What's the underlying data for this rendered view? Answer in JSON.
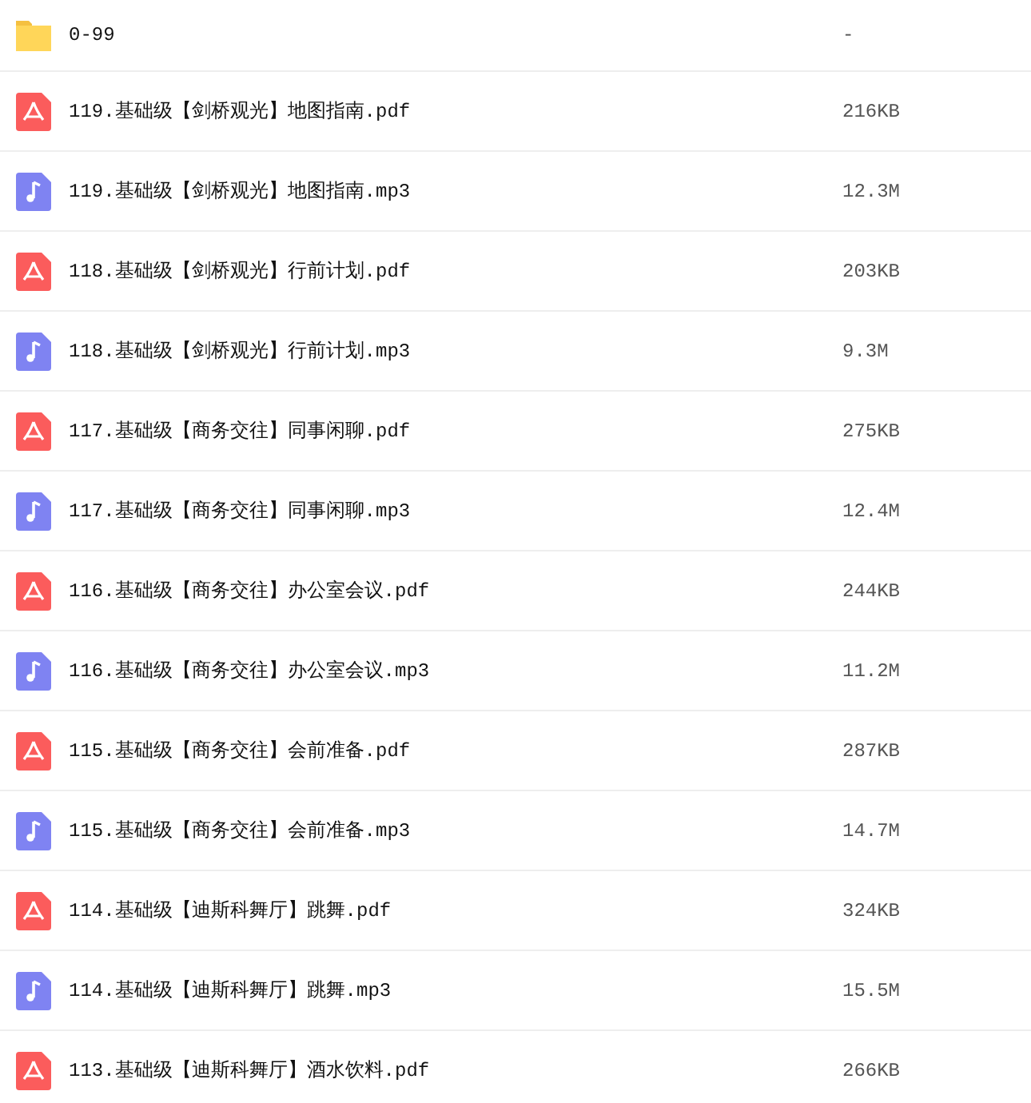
{
  "files": [
    {
      "kind": "folder",
      "name": "0-99",
      "size": "-"
    },
    {
      "kind": "pdf",
      "name": "119.基础级【剑桥观光】地图指南.pdf",
      "size": "216KB"
    },
    {
      "kind": "audio",
      "name": "119.基础级【剑桥观光】地图指南.mp3",
      "size": "12.3M"
    },
    {
      "kind": "pdf",
      "name": "118.基础级【剑桥观光】行前计划.pdf",
      "size": "203KB"
    },
    {
      "kind": "audio",
      "name": "118.基础级【剑桥观光】行前计划.mp3",
      "size": "9.3M"
    },
    {
      "kind": "pdf",
      "name": "117.基础级【商务交往】同事闲聊.pdf",
      "size": "275KB"
    },
    {
      "kind": "audio",
      "name": "117.基础级【商务交往】同事闲聊.mp3",
      "size": "12.4M"
    },
    {
      "kind": "pdf",
      "name": "116.基础级【商务交往】办公室会议.pdf",
      "size": "244KB"
    },
    {
      "kind": "audio",
      "name": "116.基础级【商务交往】办公室会议.mp3",
      "size": "11.2M"
    },
    {
      "kind": "pdf",
      "name": "115.基础级【商务交往】会前准备.pdf",
      "size": "287KB"
    },
    {
      "kind": "audio",
      "name": "115.基础级【商务交往】会前准备.mp3",
      "size": "14.7M"
    },
    {
      "kind": "pdf",
      "name": "114.基础级【迪斯科舞厅】跳舞.pdf",
      "size": "324KB"
    },
    {
      "kind": "audio",
      "name": "114.基础级【迪斯科舞厅】跳舞.mp3",
      "size": "15.5M"
    },
    {
      "kind": "pdf",
      "name": "113.基础级【迪斯科舞厅】酒水饮料.pdf",
      "size": "266KB"
    }
  ]
}
